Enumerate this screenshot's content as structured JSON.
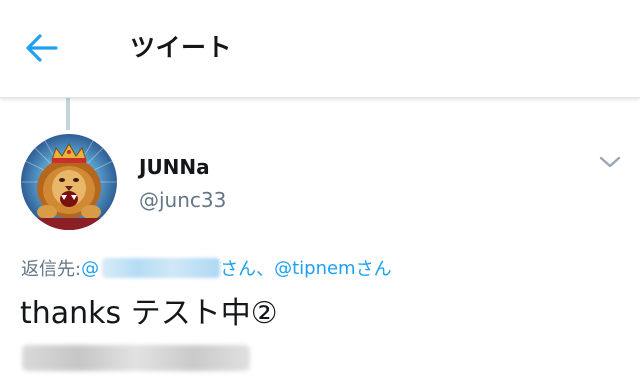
{
  "header": {
    "back_icon": "arrow-left-icon",
    "title": "ツイート"
  },
  "colors": {
    "accent": "#1da1f2",
    "text_primary": "#14171a",
    "text_secondary": "#657786",
    "thread_line": "#c5d5e0"
  },
  "tweet": {
    "display_name": "JUNNa",
    "handle": "@junc33",
    "reply_prefix": "返信先: ",
    "reply_first_mention_start": "@",
    "reply_san_1": "さん、",
    "reply_second_mention": "@tipnem",
    "reply_san_2": "さん",
    "text": "thanks テスト中②",
    "menu_icon": "chevron-down-icon"
  }
}
